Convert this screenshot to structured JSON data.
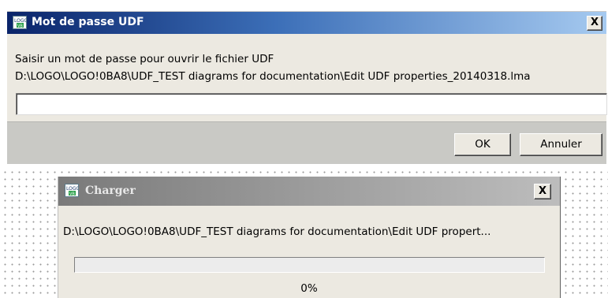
{
  "password_dialog": {
    "title": "Mot de passe UDF",
    "close_label": "X",
    "prompt": "Saisir un mot de passe pour ouvrir le fichier UDF",
    "file_path": "D:\\LOGO\\LOGO!0BA8\\UDF_TEST diagrams for documentation\\Edit UDF properties_20140318.lma",
    "password_value": "",
    "ok_label": "OK",
    "cancel_label": "Annuler"
  },
  "load_dialog": {
    "title": "Charger",
    "close_label": "X",
    "file_path": "D:\\LOGO\\LOGO!0BA8\\UDF_TEST diagrams for documentation\\Edit UDF propert...",
    "progress_text": "0%",
    "progress_fraction": 0
  },
  "icons": {
    "app_logo": "logo-soft-comfort-icon",
    "close": "close-icon"
  },
  "colors": {
    "active_title_start": "#0a246a",
    "active_title_end": "#a6caf0",
    "inactive_title": "#9c9c9c",
    "dialog_face": "#ece9e1"
  }
}
